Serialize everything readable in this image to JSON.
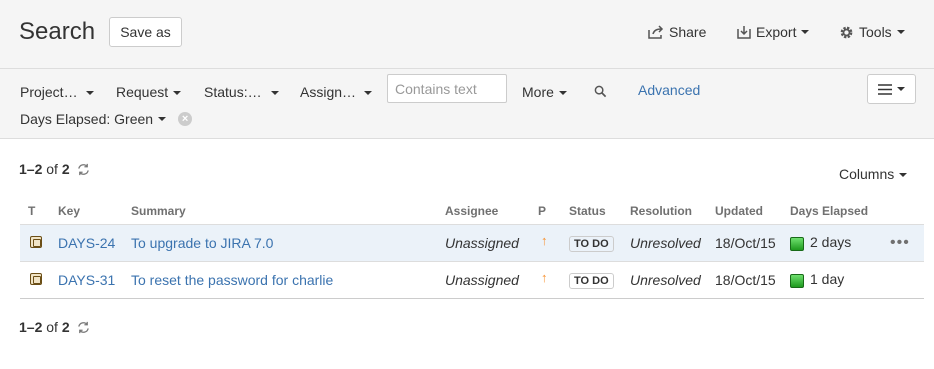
{
  "header": {
    "title": "Search",
    "save_as": "Save as",
    "share": "Share",
    "export": "Export",
    "tools": "Tools"
  },
  "filters": {
    "project": "Project…",
    "request": "Request",
    "status": "Status:…",
    "assignee": "Assign…",
    "contains_text_placeholder": "Contains text",
    "more": "More",
    "advanced": "Advanced",
    "days_elapsed": "Days Elapsed: Green"
  },
  "results": {
    "count_range": "1–2",
    "count_of": "of",
    "count_total": "2",
    "columns_label": "Columns",
    "columns": [
      "T",
      "Key",
      "Summary",
      "Assignee",
      "P",
      "Status",
      "Resolution",
      "Updated",
      "Days Elapsed"
    ],
    "rows": [
      {
        "key": "DAYS-24",
        "summary": "To upgrade to JIRA 7.0",
        "assignee": "Unassigned",
        "status": "TO DO",
        "resolution": "Unresolved",
        "updated": "18/Oct/15",
        "days_elapsed": "2 days"
      },
      {
        "key": "DAYS-31",
        "summary": "To reset the password for charlie",
        "assignee": "Unassigned",
        "status": "TO DO",
        "resolution": "Unresolved",
        "updated": "18/Oct/15",
        "days_elapsed": "1 day"
      }
    ]
  },
  "colors": {
    "link": "#3b73af",
    "priority": "#f79232",
    "selected_row": "#ebf2f9"
  }
}
